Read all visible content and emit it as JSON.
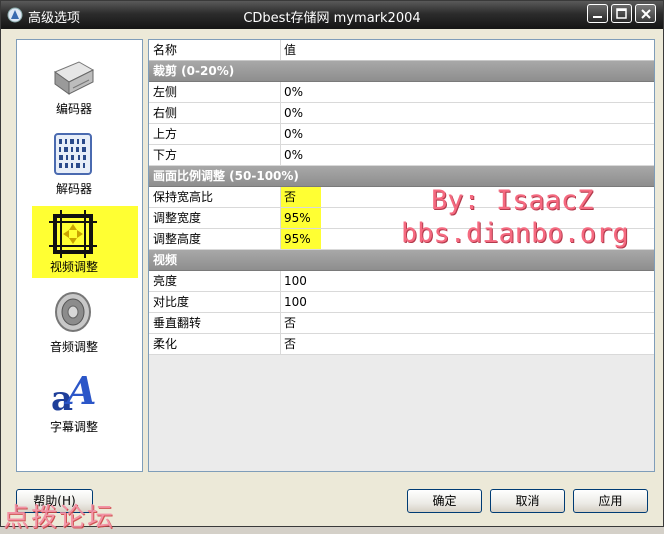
{
  "window": {
    "title": "高级选项",
    "center_title": "CDbest存储网 mymark2004"
  },
  "sidebar": {
    "items": [
      {
        "label": "编码器",
        "icon": "hard-drive-icon"
      },
      {
        "label": "解码器",
        "icon": "barcode-chip-icon"
      },
      {
        "label": "视频调整",
        "icon": "crop-frame-icon",
        "selected": true
      },
      {
        "label": "音频调整",
        "icon": "speaker-icon"
      },
      {
        "label": "字幕调整",
        "icon": "font-glyph-icon"
      }
    ]
  },
  "table": {
    "header": {
      "name": "名称",
      "value": "值"
    },
    "sections": [
      {
        "title": "裁剪 (0-20%)",
        "rows": [
          {
            "name": "左侧",
            "value": "0%"
          },
          {
            "name": "右侧",
            "value": "0%"
          },
          {
            "name": "上方",
            "value": "0%"
          },
          {
            "name": "下方",
            "value": "0%"
          }
        ]
      },
      {
        "title": "画面比例调整 (50-100%)",
        "rows": [
          {
            "name": "保持宽高比",
            "value": "否"
          },
          {
            "name": "调整宽度",
            "value": "95%"
          },
          {
            "name": "调整高度",
            "value": "95%"
          }
        ]
      },
      {
        "title": "视频",
        "rows": [
          {
            "name": "亮度",
            "value": "100"
          },
          {
            "name": "对比度",
            "value": "100"
          },
          {
            "name": "垂直翻转",
            "value": "否"
          },
          {
            "name": "柔化",
            "value": "否"
          }
        ]
      }
    ]
  },
  "watermark": {
    "line1": "By: IsaacZ",
    "line2": "bbs.dianbo.org",
    "bottom": "点拨论坛",
    "color": "#f56a80"
  },
  "buttons": {
    "help": "帮助(H)",
    "ok": "确定",
    "cancel": "取消",
    "apply": "应用"
  },
  "colors": {
    "highlight": "#ffff33",
    "section_header": "#9a9a9a"
  }
}
